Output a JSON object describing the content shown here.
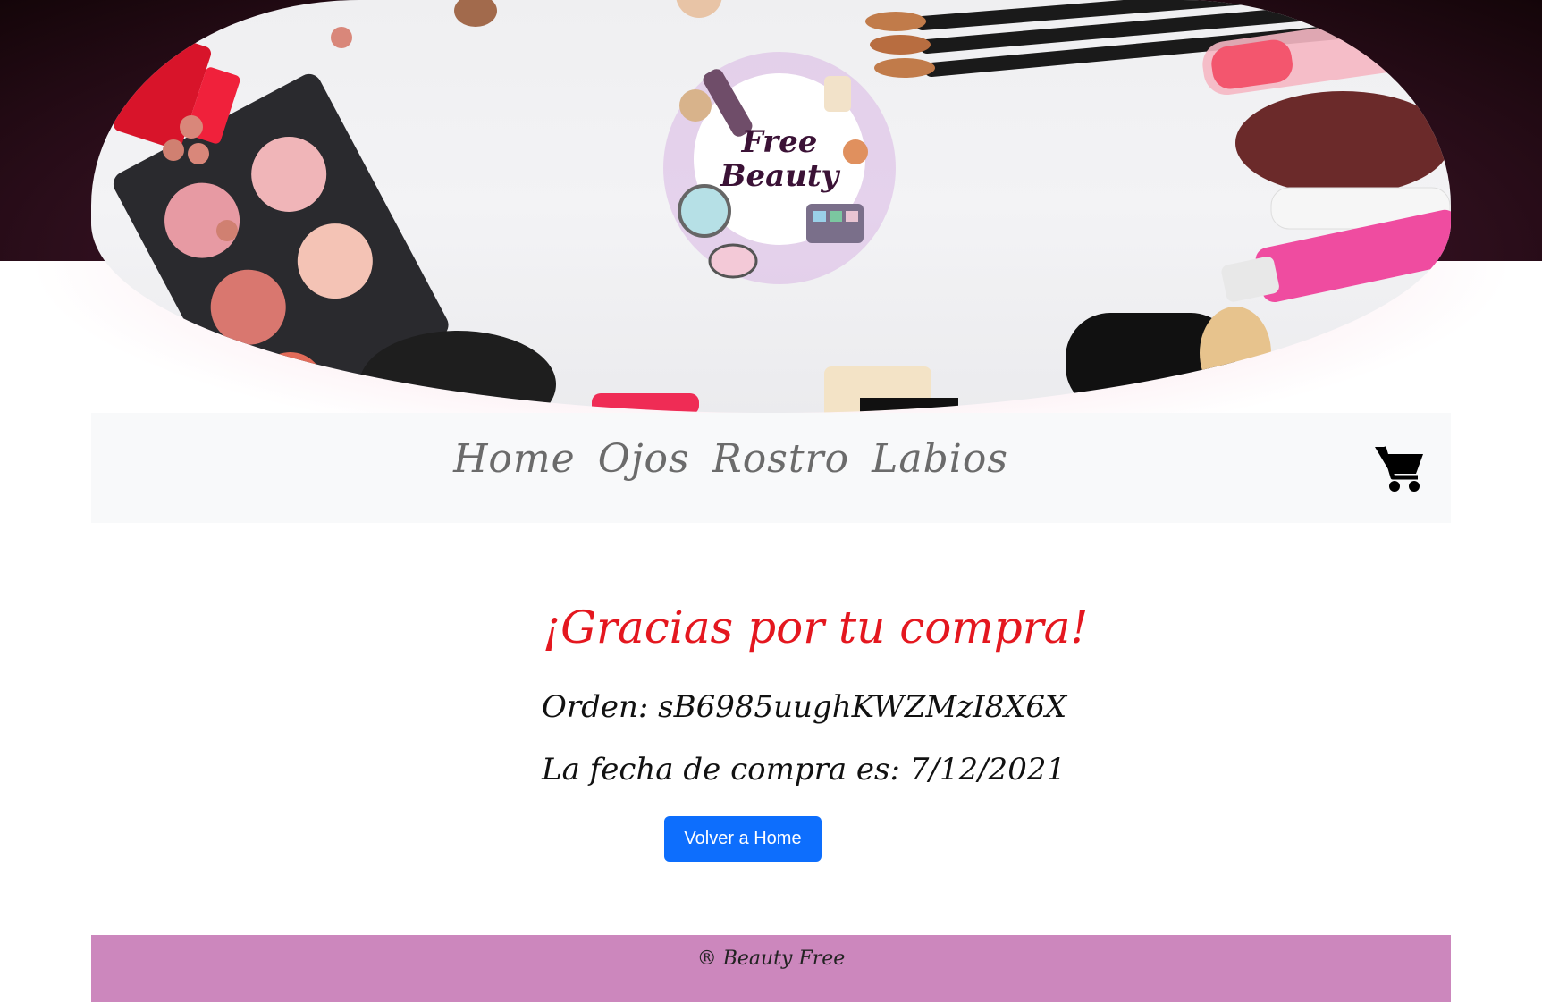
{
  "brand": {
    "logo_text_line1": "Free",
    "logo_text_line2": "Beauty"
  },
  "nav": {
    "items": [
      {
        "label": "Home"
      },
      {
        "label": "Ojos"
      },
      {
        "label": "Rostro"
      },
      {
        "label": "Labios"
      }
    ],
    "cart_icon": "shopping-cart-icon"
  },
  "main": {
    "title": "¡Gracias por tu compra!",
    "order_line": "Orden: sB6985uughKWZMzI8X6X",
    "date_line": "La fecha de compra es: 7/12/2021",
    "button_label": "Volver a Home"
  },
  "footer": {
    "text": "® Beauty Free"
  },
  "colors": {
    "title": "#e4171f",
    "button": "#0d6efd",
    "footer": "#cc87bd",
    "navbar": "#f8f9fa"
  }
}
